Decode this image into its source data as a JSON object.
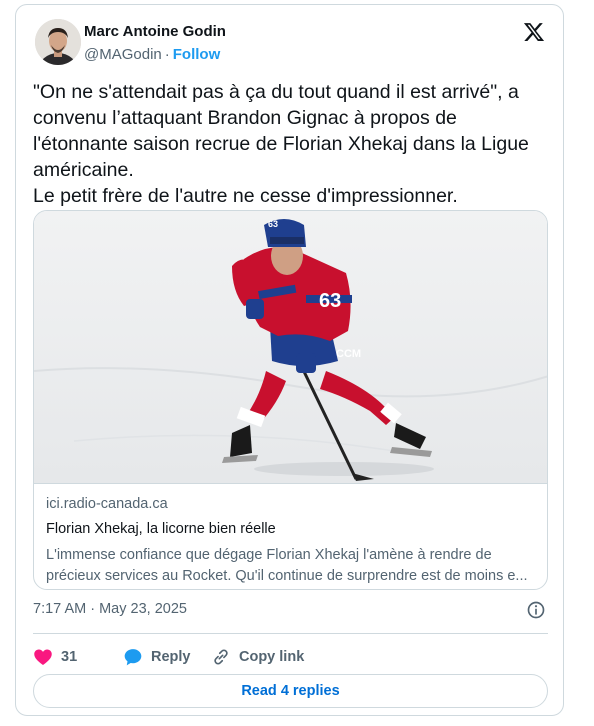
{
  "author": {
    "name": "Marc Antoine Godin",
    "handle": "@MAGodin",
    "separator": "·",
    "follow_label": "Follow"
  },
  "tweet": {
    "text_lines": [
      "\"On ne s'attendait pas à ça du tout quand il est arrivé\", a",
      "convenu l’attaquant Brandon Gignac à propos de",
      "l'étonnante saison recrue de Florian Xhekaj dans la Ligue",
      "américaine.",
      "Le petit frère de l'autre ne cesse d'impressionner."
    ],
    "timestamp": "7:17 AM · May 23, 2025"
  },
  "link_card": {
    "domain": "ici.radio-canada.ca",
    "title": "Florian Xhekaj, la licorne bien réelle",
    "description_lines": [
      "L'immense confiance que dégage Florian Xhekaj l'amène à rendre de",
      "précieux services au Rocket. Qu'il continue de surprendre est de moins e..."
    ],
    "image": {
      "jersey_number": "63",
      "helmet_number": "63",
      "brand_text": "CCM",
      "icon": "hockey-player-photo"
    }
  },
  "actions": {
    "like_count": "31",
    "reply_label": "Reply",
    "copy_label": "Copy link"
  },
  "read_replies_label": "Read 4 replies",
  "colors": {
    "accent": "#1d9bf0",
    "like": "#f91880",
    "text": "#0f1419",
    "muted": "#536471",
    "border": "#cfd9de"
  }
}
